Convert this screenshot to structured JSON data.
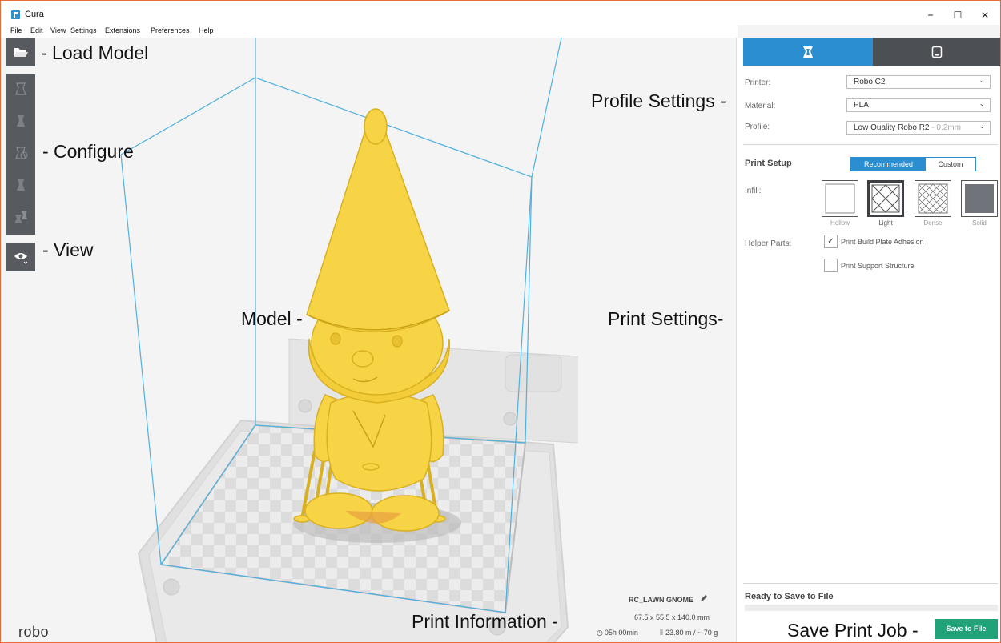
{
  "window": {
    "title": "Cura",
    "minimize": "–",
    "maximize": "☐",
    "close": "✕"
  },
  "menu": [
    "File",
    "Edit",
    "View",
    "Settings",
    "Extensions",
    "Preferences",
    "Help"
  ],
  "toolbar": {
    "icons": [
      "open-folder-icon",
      "move-tool-icon",
      "scale-tool-icon",
      "rotate-tool-icon",
      "mirror-tool-icon",
      "per-object-settings-icon",
      "eye-view-icon"
    ]
  },
  "annotations": {
    "load_model": "- Load Model",
    "configure": "- Configure",
    "view": "- View",
    "model": "Model -",
    "profile_settings": "Profile Settings -",
    "print_settings": "Print Settings-",
    "print_information": "Print Information -",
    "save_print_job": "Save Print Job -"
  },
  "sidebar": {
    "printer_label": "Printer:",
    "printer_value": "Robo C2",
    "material_label": "Material:",
    "material_value": "PLA",
    "profile_label": "Profile:",
    "profile_value": "Low Quality Robo R2",
    "profile_hint": " - 0.2mm",
    "print_setup_label": "Print Setup",
    "mode_recommended": "Recommended",
    "mode_custom": "Custom",
    "infill_label": "Infill:",
    "infill_options": [
      "Hollow",
      "Light",
      "Dense",
      "Solid"
    ],
    "infill_selected": "Light",
    "helper_label": "Helper Parts:",
    "adhesion_label": "Print Build Plate Adhesion",
    "adhesion_checked": true,
    "adhesion_check": "✓",
    "support_label": "Print Support Structure",
    "support_checked": false,
    "ready_label": "Ready to Save to File",
    "progress": 0,
    "save_button": "Save to File"
  },
  "print_info": {
    "job_name": "RC_LAWN GNOME",
    "dimensions": "67.5 x 55.5 x 140.0 mm",
    "time": "05h 00min",
    "usage": "23.80 m / ~ 70 g"
  },
  "logo": "robo",
  "colors": {
    "accent_blue": "#2a8ed0",
    "save_green": "#21a37a",
    "model_yellow": "#f7d445",
    "toolbar_gray": "#575a5e"
  }
}
